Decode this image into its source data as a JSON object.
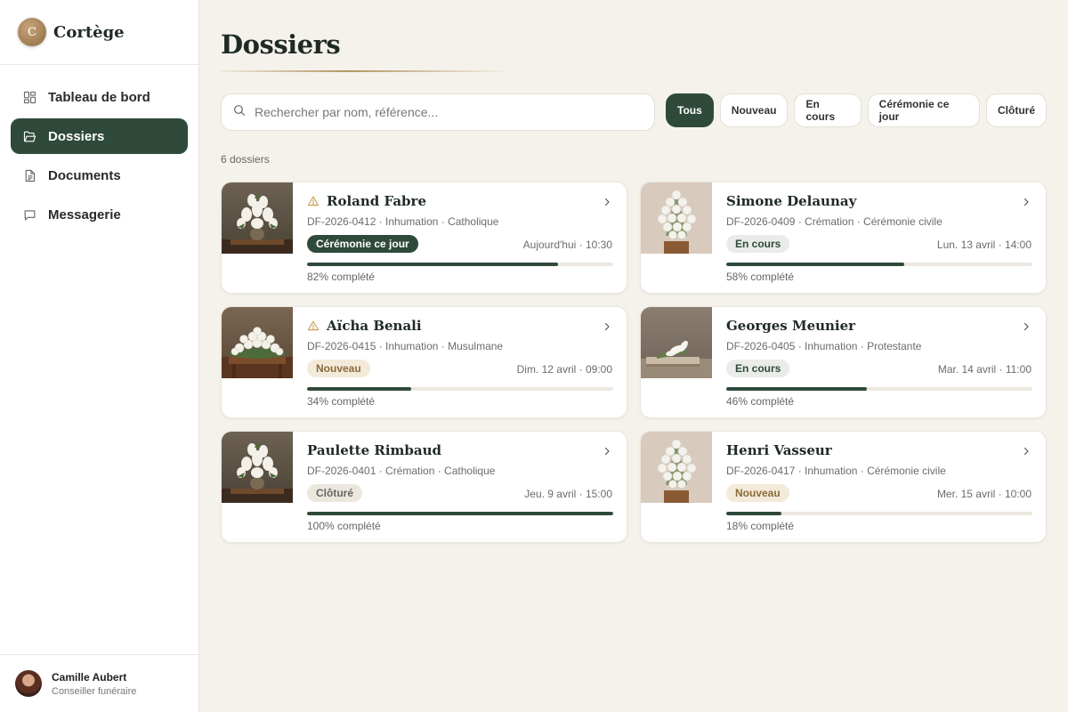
{
  "brand": {
    "logo_letter": "C",
    "name": "Cortège"
  },
  "nav": [
    {
      "label": "Tableau de bord",
      "icon": "dashboard-icon",
      "active": false
    },
    {
      "label": "Dossiers",
      "icon": "folder-icon",
      "active": true
    },
    {
      "label": "Documents",
      "icon": "document-icon",
      "active": false
    },
    {
      "label": "Messagerie",
      "icon": "message-icon",
      "active": false
    }
  ],
  "user": {
    "name": "Camille Aubert",
    "role": "Conseiller funéraire"
  },
  "page": {
    "title": "Dossiers"
  },
  "search": {
    "placeholder": "Rechercher par nom, référence..."
  },
  "filters": [
    {
      "label": "Tous",
      "active": true
    },
    {
      "label": "Nouveau",
      "active": false
    },
    {
      "label": "En cours",
      "active": false
    },
    {
      "label": "Cérémonie ce jour",
      "active": false
    },
    {
      "label": "Clôturé",
      "active": false
    }
  ],
  "count_label": "6 dossiers",
  "colors": {
    "accent": "#2f4a3a",
    "gold": "#b49664",
    "warning": "#c89a4a",
    "background": "#f5f2ec"
  },
  "dossiers": [
    {
      "name": "Roland Fabre",
      "meta": "DF-2026-0412 · Inhumation · Catholique",
      "status": "Cérémonie ce jour",
      "status_kind": "ceremonie",
      "date": "Aujourd'hui · 10:30",
      "progress": 82,
      "progress_label": "82% complété",
      "warning": true,
      "thumb": "lily-vase"
    },
    {
      "name": "Simone Delaunay",
      "meta": "DF-2026-0409 · Crémation · Cérémonie civile",
      "status": "En cours",
      "status_kind": "encours",
      "date": "Lun. 13 avril · 14:00",
      "progress": 58,
      "progress_label": "58% complété",
      "warning": false,
      "thumb": "rose-spray"
    },
    {
      "name": "Aïcha Benali",
      "meta": "DF-2026-0415 · Inhumation · Musulmane",
      "status": "Nouveau",
      "status_kind": "nouveau",
      "date": "Dim. 12 avril · 09:00",
      "progress": 34,
      "progress_label": "34% complété",
      "warning": true,
      "thumb": "rose-mound"
    },
    {
      "name": "Georges Meunier",
      "meta": "DF-2026-0405 · Inhumation · Protestante",
      "status": "En cours",
      "status_kind": "encours",
      "date": "Mar. 14 avril · 11:00",
      "progress": 46,
      "progress_label": "46% complété",
      "warning": false,
      "thumb": "lily-tray"
    },
    {
      "name": "Paulette Rimbaud",
      "meta": "DF-2026-0401 · Crémation · Catholique",
      "status": "Clôturé",
      "status_kind": "cloture",
      "date": "Jeu. 9 avril · 15:00",
      "progress": 100,
      "progress_label": "100% complété",
      "warning": false,
      "thumb": "lily-vase"
    },
    {
      "name": "Henri Vasseur",
      "meta": "DF-2026-0417 · Inhumation · Cérémonie civile",
      "status": "Nouveau",
      "status_kind": "nouveau",
      "date": "Mer. 15 avril · 10:00",
      "progress": 18,
      "progress_label": "18% complété",
      "warning": false,
      "thumb": "rose-spray"
    }
  ]
}
